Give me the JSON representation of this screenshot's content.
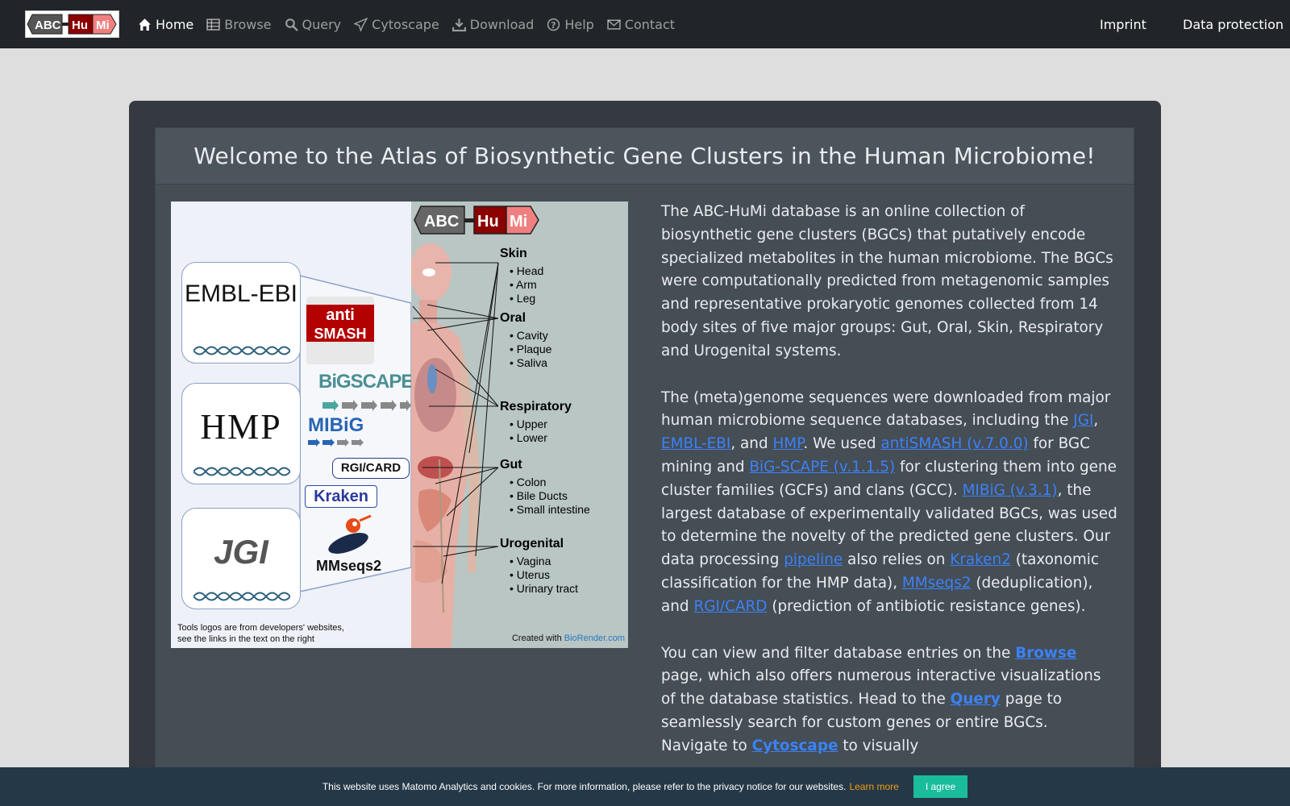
{
  "brand": {
    "logo_parts": [
      "ABC",
      "Hu",
      "Mi"
    ]
  },
  "nav": {
    "items": [
      {
        "label": "Home",
        "icon": "home-icon",
        "active": true
      },
      {
        "label": "Browse",
        "icon": "table-icon"
      },
      {
        "label": "Query",
        "icon": "search-icon"
      },
      {
        "label": "Cytoscape",
        "icon": "paper-plane-icon"
      },
      {
        "label": "Download",
        "icon": "download-icon"
      },
      {
        "label": "Help",
        "icon": "question-circle-icon"
      },
      {
        "label": "Contact",
        "icon": "envelope-icon"
      }
    ],
    "imprint": "Imprint",
    "data_protection": "Data protection"
  },
  "page": {
    "title": "Welcome to the Atlas of Biosynthetic Gene Clusters in the Human Microbiome!"
  },
  "figure": {
    "databases": [
      "EMBL-EBI",
      "HMP",
      "JGI"
    ],
    "tools": [
      "anti",
      "SMASH",
      "BiGSCAPE",
      "MIBiG",
      "RGI/CARD",
      "Kraken",
      "MMseqs2"
    ],
    "body_sites": [
      {
        "name": "Skin",
        "parts": [
          "Head",
          "Arm",
          "Leg"
        ]
      },
      {
        "name": "Oral",
        "parts": [
          "Cavity",
          "Plaque",
          "Saliva"
        ]
      },
      {
        "name": "Respiratory",
        "parts": [
          "Upper",
          "Lower"
        ]
      },
      {
        "name": "Gut",
        "parts": [
          "Colon",
          "Bile Ducts",
          "Small intestine"
        ]
      },
      {
        "name": "Urogenital",
        "parts": [
          "Vagina",
          "Uterus",
          "Urinary tract"
        ]
      }
    ],
    "caption_line1": "Tools logos are from developers' websites,",
    "caption_line2": "see the links in the text on the right",
    "created_with": "Created with ",
    "created_link": "BioRender.com"
  },
  "intro": {
    "p1": "The ABC-HuMi database is an online collection of biosynthetic gene clusters (BGCs) that putatively encode specialized metabolites in the human microbiome. The BGCs were computationally predicted from metagenomic samples and representative prokaryotic genomes collected from 14 body sites of five major groups: Gut, Oral, Skin, Respiratory and Urogenital systems.",
    "p2": {
      "t1": "The (meta)genome sequences were downloaded from major human microbiome sequence databases, including the ",
      "l_jgi": "JGI",
      "t2": ", ",
      "l_embl": "EMBL-EBI",
      "t3": ", and ",
      "l_hmp": "HMP",
      "t4": ". We used ",
      "l_antismash": "antiSMASH (v.7.0.0)",
      "t5": " for BGC mining and ",
      "l_bigscape": "BiG-SCAPE (v.1.1.5)",
      "t6": " for clustering them into gene cluster families (GCFs) and clans (GCC). ",
      "l_mibig": "MIBiG (v.3.1)",
      "t7": ", the largest database of experimentally validated BGCs, was used to determine the novelty of the predicted gene clusters. Our data processing ",
      "l_pipeline": "pipeline",
      "t8": " also relies on ",
      "l_kraken": "Kraken2",
      "t9": " (taxonomic classification for the HMP data), ",
      "l_mmseqs": "MMseqs2",
      "t10": " (deduplication), and ",
      "l_rgi": "RGI/CARD",
      "t11": " (prediction of antibiotic resistance genes)."
    },
    "p3": {
      "t1": "You can view and filter database entries on the ",
      "l_browse": "Browse",
      "t2": " page, which also offers numerous interactive visualizations of the database statistics. Head to the ",
      "l_query": "Query",
      "t3": " page to seamlessly search for custom genes or entire BGCs. Navigate to ",
      "l_cytoscape": "Cytoscape",
      "t4": " to visually"
    }
  },
  "cookie": {
    "text": "This website uses Matomo Analytics and cookies. For more information, please refer to the privacy notice for our websites.",
    "learn_more": "Learn more",
    "agree": "I agree"
  }
}
